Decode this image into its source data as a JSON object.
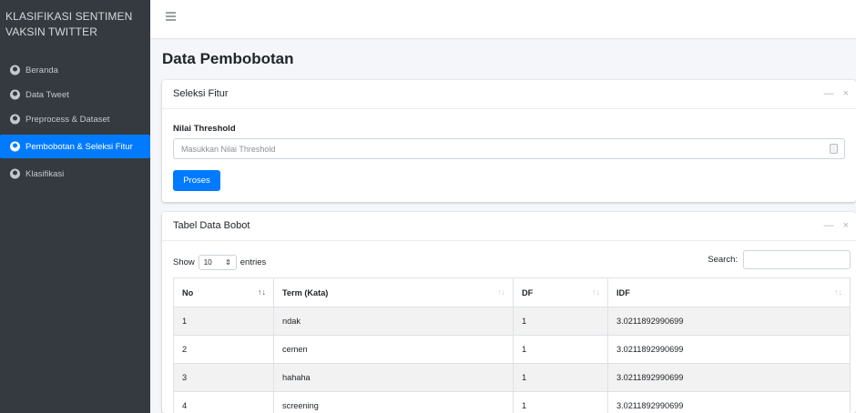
{
  "brand": {
    "line1": "KLASIFIKASI SENTIMEN",
    "line2": "VAKSIN TWITTER"
  },
  "sidebar": {
    "items": [
      {
        "label": "Beranda",
        "icon": "tachometer-icon",
        "active": false
      },
      {
        "label": "Data Tweet",
        "icon": "tachometer-icon",
        "active": false
      },
      {
        "label": "Preprocess & Dataset",
        "icon": "tachometer-icon",
        "active": false
      },
      {
        "label": "Pembobotan & Seleksi Fitur",
        "icon": "tachometer-icon",
        "active": true
      },
      {
        "label": "Klasifikasi",
        "icon": "tachometer-icon",
        "active": false
      }
    ]
  },
  "page": {
    "title": "Data Pembobotan"
  },
  "seleksi": {
    "title": "Seleksi Fitur",
    "threshold_label": "Nilai Threshold",
    "threshold_placeholder": "Masukkan Nilai Threshold",
    "threshold_value": "",
    "button": "Proses"
  },
  "tabel": {
    "title": "Tabel Data Bobot",
    "show": "Show",
    "entries_value": "10",
    "entries": "entries",
    "search_label": "Search:",
    "columns": [
      "No",
      "Term (Kata)",
      "DF",
      "IDF"
    ],
    "rows": [
      {
        "no": "1",
        "term": "ndak",
        "df": "1",
        "idf": "3.0211892990699"
      },
      {
        "no": "2",
        "term": "cemen",
        "df": "1",
        "idf": "3.0211892990699"
      },
      {
        "no": "3",
        "term": "hahaha",
        "df": "1",
        "idf": "3.0211892990699"
      },
      {
        "no": "4",
        "term": "screening",
        "df": "1",
        "idf": "3.0211892990699"
      }
    ]
  },
  "card_tools": {
    "minimize": "—",
    "close": "×"
  },
  "colors": {
    "sidebar": "#343a40",
    "accent": "#007bff"
  }
}
